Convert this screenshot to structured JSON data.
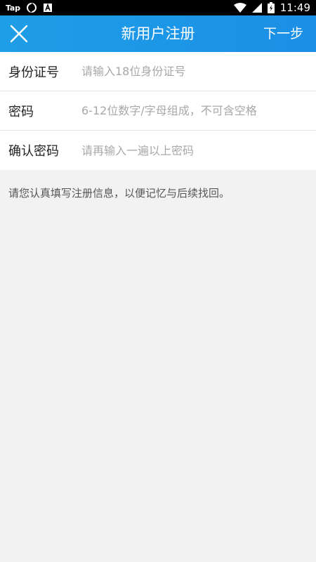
{
  "status_bar": {
    "left_text": "Tap",
    "left_icons": [
      "sync-icon",
      "font-a-icon"
    ],
    "right_icons": [
      "wifi-icon",
      "signal-icon",
      "battery-icon"
    ],
    "time": "11:49"
  },
  "header": {
    "title": "新用户注册",
    "close_icon": "close-icon",
    "next_label": "下一步",
    "accent_color": "#1e9ee6"
  },
  "form": {
    "fields": [
      {
        "label": "身份证号",
        "value": "",
        "placeholder": "请输入18位身份证号"
      },
      {
        "label": "密码",
        "value": "",
        "placeholder": "6-12位数字/字母组成，不可含空格"
      },
      {
        "label": "确认密码",
        "value": "",
        "placeholder": "请再输入一遍以上密码"
      }
    ]
  },
  "notice": "请您认真填写注册信息，以便记忆与后续找回。"
}
